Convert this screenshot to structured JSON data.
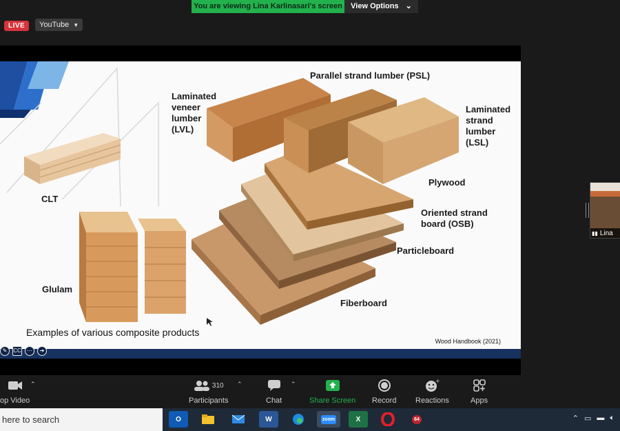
{
  "banner": {
    "viewing_text": "You are viewing Lina Karlinasari's screen",
    "view_options": "View Options"
  },
  "live_badge": "LIVE",
  "stream_target": "YouTube",
  "slide": {
    "labels": {
      "psl": "Parallel strand lumber (PSL)",
      "lvl": "Laminated\nveneer\nlumber\n(LVL)",
      "lsl": "Laminated\nstrand\nlumber\n(LSL)",
      "plywood": "Plywood",
      "osb": "Oriented strand\nboard (OSB)",
      "particleboard": "Particleboard",
      "fiberboard": "Fiberboard",
      "clt": "CLT",
      "glulam": "Glulam"
    },
    "caption": "Examples of various composite products",
    "source": "Wood Handbook (2021)",
    "cc": "CC"
  },
  "participant": {
    "name": "Lina"
  },
  "toolbar": {
    "stop_video": "op Video",
    "participants": "Participants",
    "participants_count": "310",
    "chat": "Chat",
    "share_screen": "Share Screen",
    "record": "Record",
    "reactions": "Reactions",
    "apps": "Apps"
  },
  "taskbar": {
    "search_placeholder": "here to search",
    "apps": [
      "outlook",
      "file-explorer",
      "mail",
      "word",
      "edge",
      "zoom",
      "excel",
      "opera",
      "app-64"
    ],
    "zoom_label": "zoom",
    "app64_label": "64"
  },
  "colors": {
    "zoom_green": "#23b14d",
    "live_red": "#d7333b",
    "slide_bar": "#17325f",
    "taskbar": "#1f2a38"
  }
}
